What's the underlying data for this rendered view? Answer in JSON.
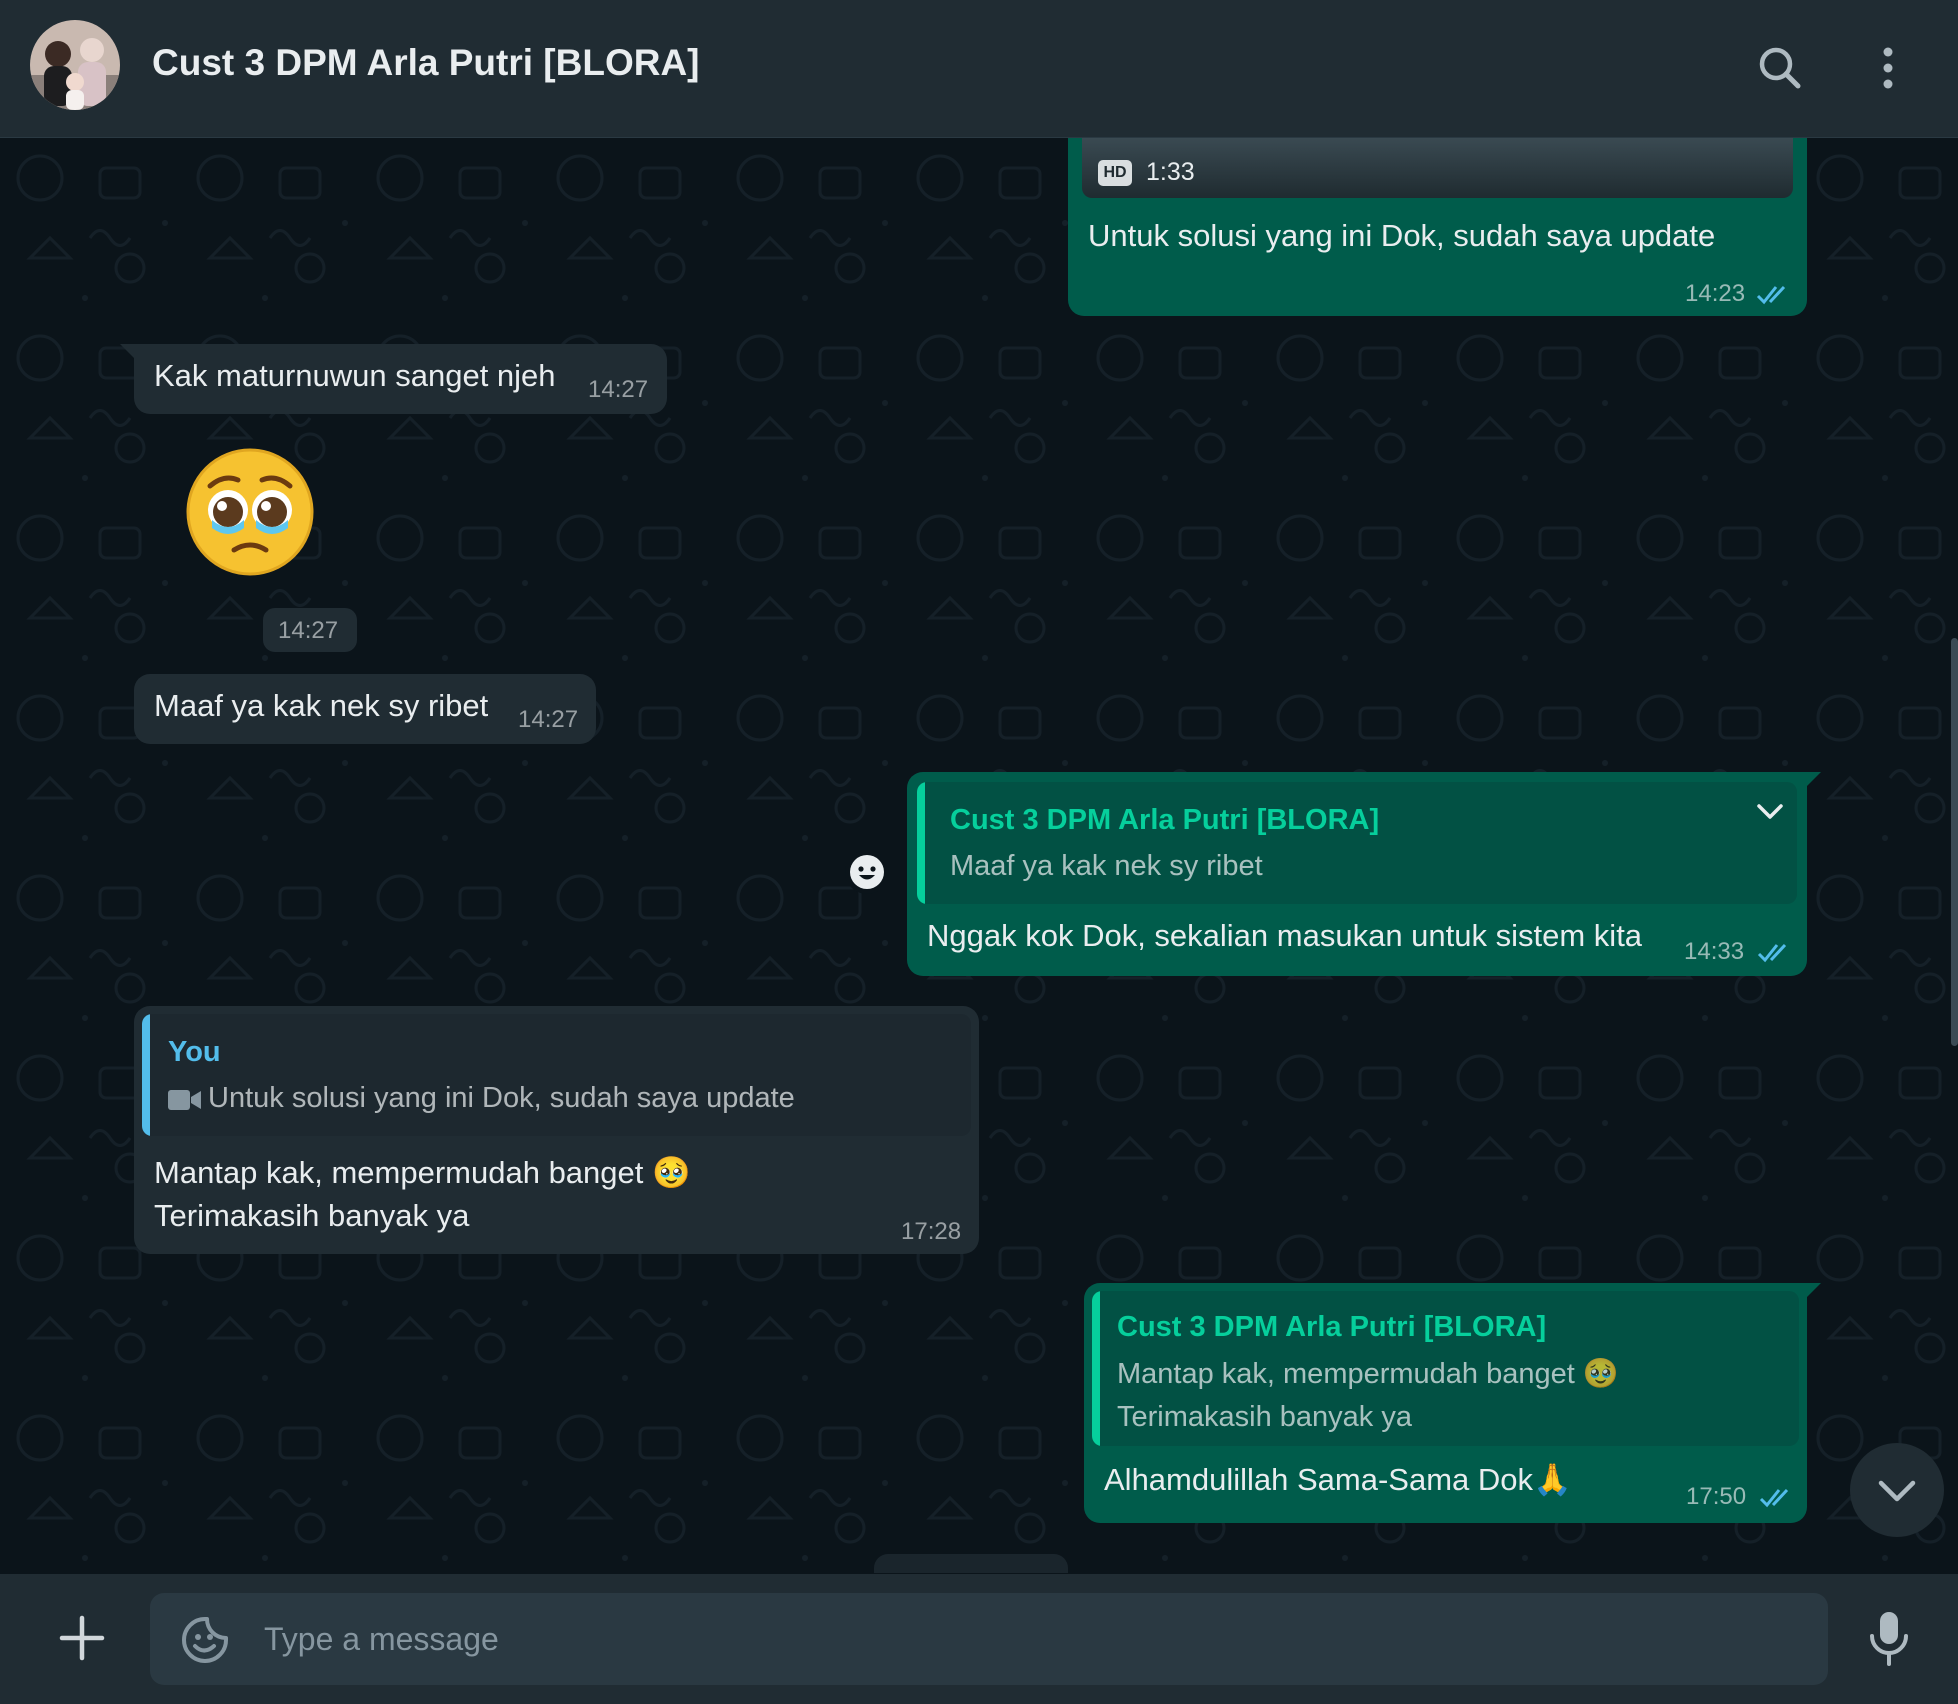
{
  "header": {
    "contact_name": "Cust 3 DPM Arla Putri [BLORA]",
    "icons": [
      "avatar",
      "search-icon",
      "more-icon"
    ]
  },
  "messages": {
    "m1": {
      "direction": "out",
      "video_badge": "HD",
      "video_duration": "1:33",
      "text": "Untuk solusi yang ini Dok, sudah saya update",
      "time": "14:23",
      "status": "read"
    },
    "m2": {
      "direction": "in",
      "text": "Kak maturnuwun sanget njeh",
      "time": "14:27"
    },
    "m3": {
      "direction": "in",
      "emoji": "🥹",
      "time": "14:27"
    },
    "m4": {
      "direction": "in",
      "text": "Maaf ya kak nek sy ribet",
      "time": "14:27"
    },
    "m5": {
      "direction": "out",
      "quote_name": "Cust 3 DPM Arla Putri [BLORA]",
      "quote_text": "Maaf ya kak nek sy ribet",
      "text": "Nggak kok Dok, sekalian masukan untuk sistem kita",
      "time": "14:33",
      "status": "read"
    },
    "m6": {
      "direction": "in",
      "quote_name": "You",
      "quote_text": "Untuk solusi yang ini Dok, sudah saya update",
      "text_line1": "Mantap kak, mempermudah banget 🥹",
      "text_line2": "Terimakasih banyak ya",
      "time": "17:28"
    },
    "m7": {
      "direction": "out",
      "quote_name": "Cust 3 DPM Arla Putri [BLORA]",
      "quote_line1": "Mantap kak, mempermudah banget 🥹",
      "quote_line2": "Terimakasih banyak ya",
      "text": "Alhamdulillah Sama-Sama Dok🙏",
      "time": "17:50",
      "status": "read"
    }
  },
  "composer": {
    "placeholder": "Type a message",
    "icons": [
      "plus-icon",
      "sticker-icon",
      "mic-icon"
    ]
  },
  "colors": {
    "header_bg": "#202c33",
    "chat_bg": "#0b141a",
    "incoming_bubble": "#202c33",
    "outgoing_bubble": "#005c4b",
    "quote_name_green": "#06cf9c",
    "quote_name_blue": "#53bdeb",
    "read_tick": "#53bdeb"
  }
}
